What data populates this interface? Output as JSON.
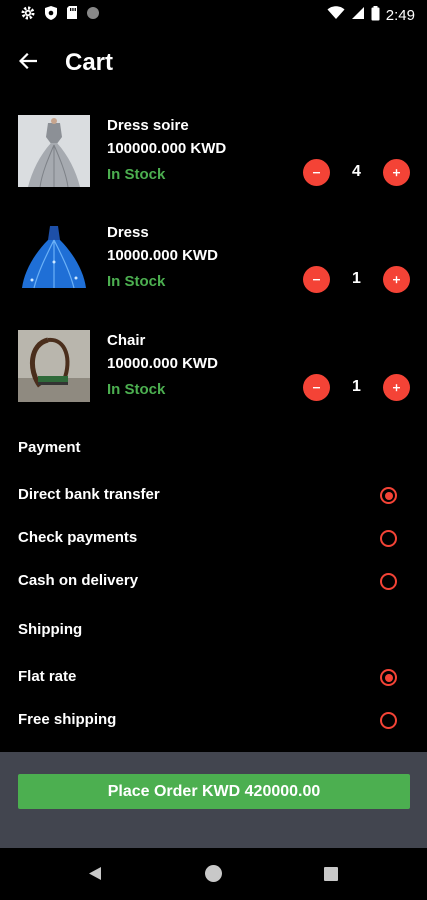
{
  "status_bar": {
    "time": "2:49",
    "left_icons": [
      "gear-icon",
      "shield-icon",
      "sd-card-icon",
      "circle-icon"
    ],
    "right_icons": [
      "wifi-icon",
      "signal-icon",
      "battery-icon"
    ]
  },
  "app_bar": {
    "title": "Cart",
    "back_icon": "arrow-left-icon"
  },
  "cart": {
    "items": [
      {
        "name": "Dress soire",
        "price": "100000.000 KWD",
        "stock": "In Stock",
        "quantity": "4",
        "image": "gown-photo"
      },
      {
        "name": "Dress",
        "price": "10000.000 KWD",
        "stock": "In Stock",
        "quantity": "1",
        "image": "blue-dress-photo"
      },
      {
        "name": "Chair",
        "price": "10000.000 KWD",
        "stock": "In Stock",
        "quantity": "1",
        "image": "chair-photo"
      }
    ]
  },
  "payment": {
    "label": "Payment",
    "options": [
      {
        "label": "Direct bank transfer",
        "selected": true
      },
      {
        "label": "Check payments",
        "selected": false
      },
      {
        "label": "Cash on delivery",
        "selected": false
      }
    ]
  },
  "shipping": {
    "label": "Shipping",
    "options": [
      {
        "label": "Flat rate",
        "selected": true
      },
      {
        "label": "Free shipping",
        "selected": false
      }
    ]
  },
  "order": {
    "button_label": "Place Order KWD 420000.00"
  },
  "colors": {
    "accent_red": "#f44336",
    "stock_green": "#4caf50",
    "button_green": "#4caf50",
    "bottom_panel": "#42454f"
  },
  "nav_bar": {
    "icons": [
      "nav-back-icon",
      "nav-home-icon",
      "nav-recents-icon"
    ]
  }
}
